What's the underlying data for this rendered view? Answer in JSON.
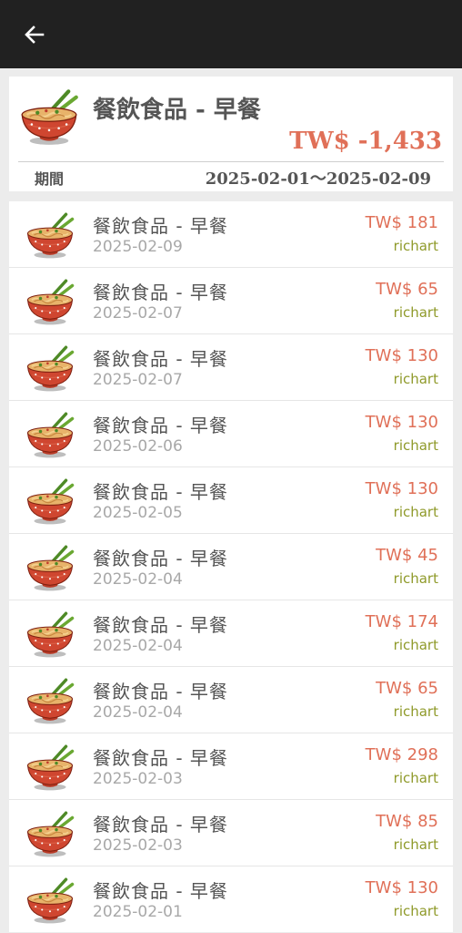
{
  "header": {
    "back_icon": "arrow-left-icon"
  },
  "summary": {
    "title": "餐飲食品 - 早餐",
    "total": "TW$ -1,433",
    "period_label": "期間",
    "period_range": "2025-02-01～2025-02-09",
    "icon": "noodle-bowl-icon"
  },
  "colors": {
    "amount": "#e07058",
    "user": "#8f9a2a",
    "topbar": "#212121"
  },
  "records": [
    {
      "category": "餐飲食品 - 早餐",
      "date": "2025-02-09",
      "amount": "TW$ 181",
      "user": "richart"
    },
    {
      "category": "餐飲食品 - 早餐",
      "date": "2025-02-07",
      "amount": "TW$ 65",
      "user": "richart"
    },
    {
      "category": "餐飲食品 - 早餐",
      "date": "2025-02-07",
      "amount": "TW$ 130",
      "user": "richart"
    },
    {
      "category": "餐飲食品 - 早餐",
      "date": "2025-02-06",
      "amount": "TW$ 130",
      "user": "richart"
    },
    {
      "category": "餐飲食品 - 早餐",
      "date": "2025-02-05",
      "amount": "TW$ 130",
      "user": "richart"
    },
    {
      "category": "餐飲食品 - 早餐",
      "date": "2025-02-04",
      "amount": "TW$ 45",
      "user": "richart"
    },
    {
      "category": "餐飲食品 - 早餐",
      "date": "2025-02-04",
      "amount": "TW$ 174",
      "user": "richart"
    },
    {
      "category": "餐飲食品 - 早餐",
      "date": "2025-02-04",
      "amount": "TW$ 65",
      "user": "richart"
    },
    {
      "category": "餐飲食品 - 早餐",
      "date": "2025-02-03",
      "amount": "TW$ 298",
      "user": "richart"
    },
    {
      "category": "餐飲食品 - 早餐",
      "date": "2025-02-03",
      "amount": "TW$ 85",
      "user": "richart"
    },
    {
      "category": "餐飲食品 - 早餐",
      "date": "2025-02-01",
      "amount": "TW$ 130",
      "user": "richart"
    }
  ]
}
